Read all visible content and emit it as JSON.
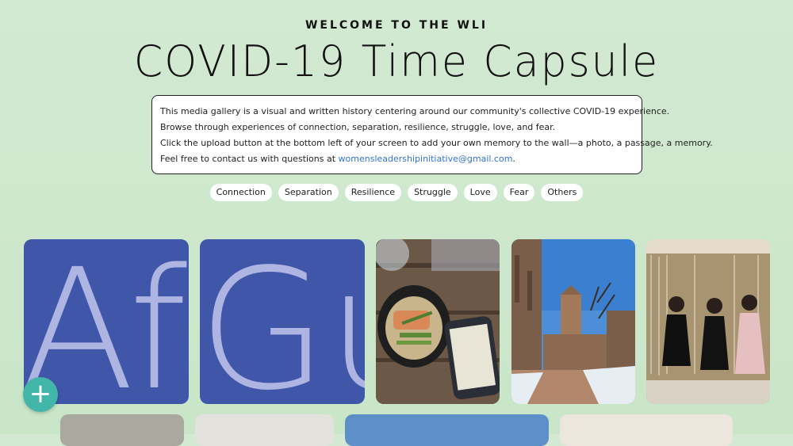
{
  "header": {
    "eyebrow": "WELCOME TO THE WLI",
    "title": "COVID-19 Time Capsule"
  },
  "description": {
    "line1": "This media gallery is a visual and written history centering around our community's collective COVID-19 experience.",
    "line2": "Browse through experiences of connection, separation, resilience, struggle, love, and fear.",
    "line3": "Click the upload button at the bottom left of your screen to add your own memory to the wall—a photo, a passage, a memory.",
    "line4_prefix": "Feel free to contact us with questions at ",
    "email": "womensleadershipinitiative@gmail.com",
    "line4_suffix": "."
  },
  "filters": [
    "Connection",
    "Separation",
    "Resilience",
    "Struggle",
    "Love",
    "Fear",
    "Others"
  ],
  "gallery": {
    "text_tile_1": "Aft",
    "text_tile_2": "Gu"
  },
  "upload_button": {
    "label": "+",
    "icon": "plus-icon"
  },
  "colors": {
    "accent": "#42b6a8",
    "tile_blue": "#4056a8",
    "link": "#3572d6"
  }
}
